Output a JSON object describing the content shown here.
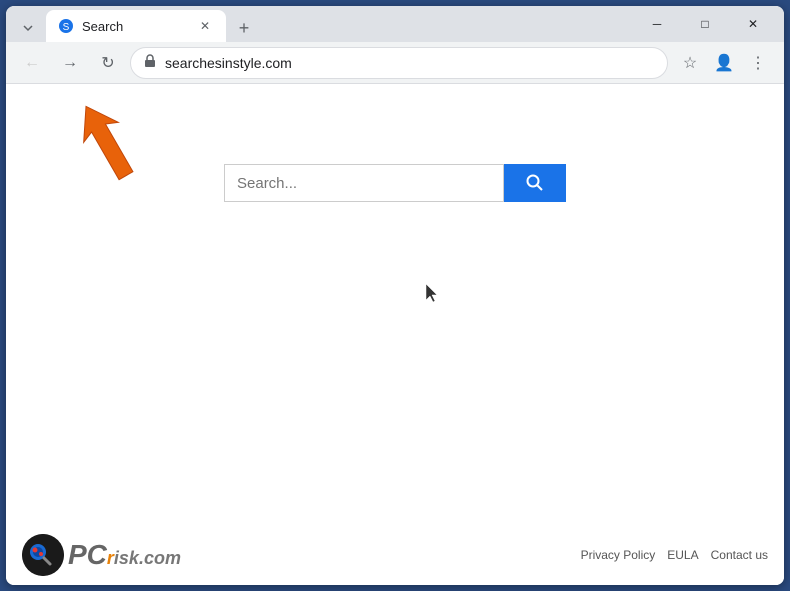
{
  "browser": {
    "tab": {
      "title": "Search",
      "favicon": "🌐"
    },
    "new_tab_label": "+",
    "window_controls": {
      "minimize": "─",
      "maximize": "□",
      "close": "✕"
    }
  },
  "toolbar": {
    "back_label": "←",
    "forward_label": "→",
    "reload_label": "↻",
    "address": "searchesinstyle.com",
    "address_icon": "🔒",
    "bookmark_label": "☆",
    "profile_label": "👤",
    "menu_label": "⋮"
  },
  "page": {
    "search_placeholder": "Search...",
    "search_button_icon": "🔍"
  },
  "footer": {
    "privacy_policy": "Privacy Policy",
    "eula": "EULA",
    "contact": "Contact us",
    "logo_text_main": "PC",
    "logo_text_sub": "risk.com"
  }
}
